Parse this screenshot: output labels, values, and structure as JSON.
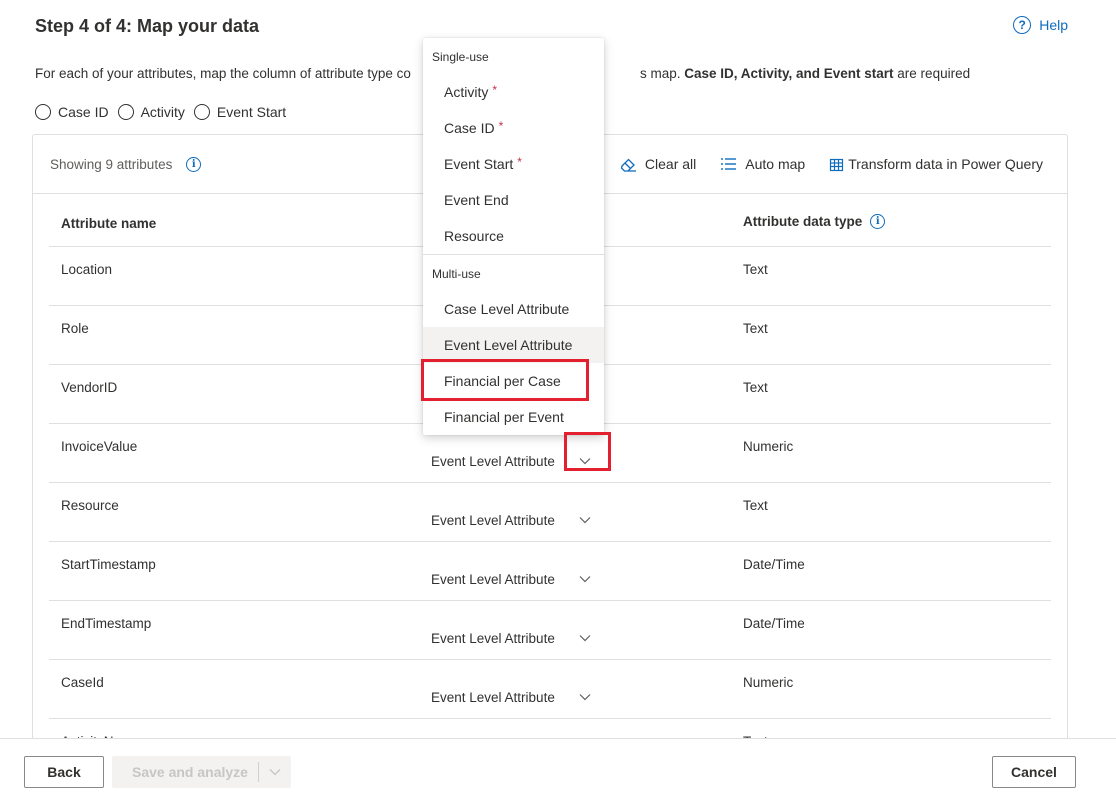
{
  "header": {
    "title": "Step 4 of 4: Map your data",
    "help_label": "Help"
  },
  "description": {
    "part1": "For each of your attributes, map the column of attribute type co",
    "part2": "s map. ",
    "bold": "Case ID, Activity, and Event start",
    "part3": " are required"
  },
  "legend": {
    "items": [
      "Case ID",
      "Activity",
      "Event Start"
    ]
  },
  "toolbar": {
    "showing": "Showing 9 attributes",
    "clear_all": "Clear all",
    "auto_map": "Auto map",
    "transform": "Transform data in Power Query"
  },
  "table": {
    "headers": {
      "name": "Attribute name",
      "type": "Attribute data type"
    },
    "rows": [
      {
        "name": "Location",
        "mapping": "",
        "type": "Text"
      },
      {
        "name": "Role",
        "mapping": "",
        "type": "Text"
      },
      {
        "name": "VendorID",
        "mapping": "",
        "type": "Text"
      },
      {
        "name": "InvoiceValue",
        "mapping": "Event Level Attribute",
        "type": "Numeric"
      },
      {
        "name": "Resource",
        "mapping": "Event Level Attribute",
        "type": "Text"
      },
      {
        "name": "StartTimestamp",
        "mapping": "Event Level Attribute",
        "type": "Date/Time"
      },
      {
        "name": "EndTimestamp",
        "mapping": "Event Level Attribute",
        "type": "Date/Time"
      },
      {
        "name": "CaseId",
        "mapping": "Event Level Attribute",
        "type": "Numeric"
      },
      {
        "name": "ActivityN",
        "mapping": "",
        "type": "Text"
      }
    ]
  },
  "dropdown": {
    "group_single": "Single-use",
    "single_items": [
      {
        "label": "Activity",
        "required": "*"
      },
      {
        "label": "Case ID",
        "required": "*"
      },
      {
        "label": "Event Start",
        "required": "*"
      },
      {
        "label": "Event End",
        "required": ""
      },
      {
        "label": "Resource",
        "required": ""
      }
    ],
    "group_multi": "Multi-use",
    "multi_items": [
      {
        "label": "Case Level Attribute"
      },
      {
        "label": "Event Level Attribute"
      },
      {
        "label": "Financial per Case"
      },
      {
        "label": "Financial per Event"
      }
    ],
    "hovered_item": "Event Level Attribute",
    "highlighted_item": "Financial per Case"
  },
  "footer": {
    "back": "Back",
    "save": "Save and analyze",
    "cancel": "Cancel"
  },
  "colors": {
    "accent": "#0f6cbd",
    "highlight": "#e3202f",
    "required": "#c4314b"
  }
}
